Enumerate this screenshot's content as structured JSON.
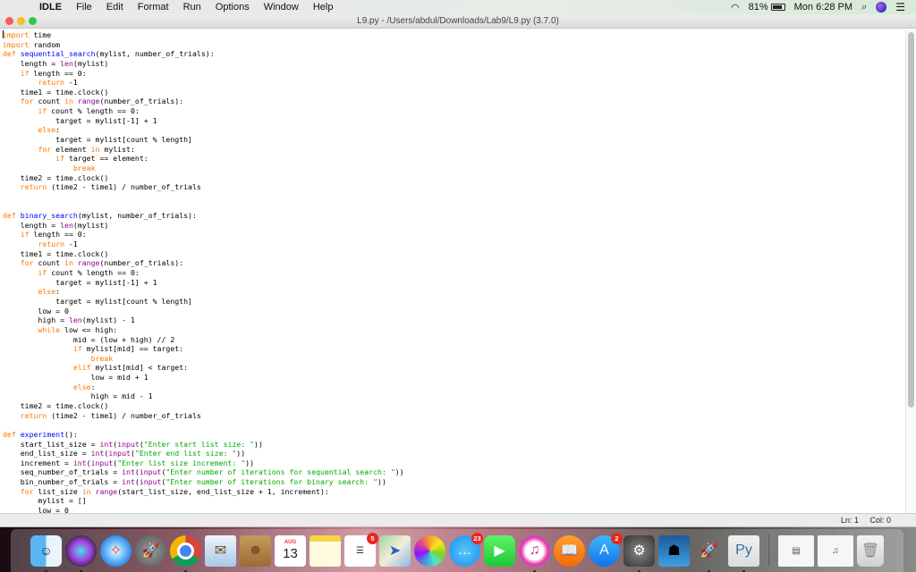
{
  "menubar": {
    "apple": "",
    "app_name": "IDLE",
    "items": [
      "File",
      "Edit",
      "Format",
      "Run",
      "Options",
      "Window",
      "Help"
    ],
    "battery_percent": "81%",
    "clock": "Mon 6:28 PM",
    "search_glyph": "⌕",
    "list_glyph": "☰",
    "wifi_glyph": "◠"
  },
  "window": {
    "title": "L9.py - /Users/abdul/Downloads/Lab9/L9.py (3.7.0)"
  },
  "editor": {
    "lines": [
      [
        [
          "kw",
          "import"
        ],
        [
          "",
          " time"
        ]
      ],
      [
        [
          "kw",
          "import"
        ],
        [
          "",
          " random"
        ]
      ],
      [
        [
          "kw",
          "def"
        ],
        [
          "",
          " "
        ],
        [
          "def",
          "sequential_search"
        ],
        [
          "",
          "(mylist, number_of_trials):"
        ]
      ],
      [
        [
          "",
          "    length = "
        ],
        [
          "bi",
          "len"
        ],
        [
          "",
          "(mylist)"
        ]
      ],
      [
        [
          "",
          "    "
        ],
        [
          "kw",
          "if"
        ],
        [
          "",
          " length == 0:"
        ]
      ],
      [
        [
          "",
          "        "
        ],
        [
          "kw",
          "return"
        ],
        [
          "",
          " -1"
        ]
      ],
      [
        [
          "",
          "    time1 = time.clock()"
        ]
      ],
      [
        [
          "",
          "    "
        ],
        [
          "kw",
          "for"
        ],
        [
          "",
          " count "
        ],
        [
          "kw",
          "in"
        ],
        [
          "",
          " "
        ],
        [
          "bi",
          "range"
        ],
        [
          "",
          "(number_of_trials):"
        ]
      ],
      [
        [
          "",
          "        "
        ],
        [
          "kw",
          "if"
        ],
        [
          "",
          " count % length == 0:"
        ]
      ],
      [
        [
          "",
          "            target = mylist[-1] + 1"
        ]
      ],
      [
        [
          "",
          "        "
        ],
        [
          "kw",
          "else"
        ],
        [
          "",
          ":"
        ]
      ],
      [
        [
          "",
          "            target = mylist[count % length]"
        ]
      ],
      [
        [
          "",
          "        "
        ],
        [
          "kw",
          "for"
        ],
        [
          "",
          " element "
        ],
        [
          "kw",
          "in"
        ],
        [
          "",
          " mylist:"
        ]
      ],
      [
        [
          "",
          "            "
        ],
        [
          "kw",
          "if"
        ],
        [
          "",
          " target == element:"
        ]
      ],
      [
        [
          "",
          "                "
        ],
        [
          "kw",
          "break"
        ]
      ],
      [
        [
          "",
          "    time2 = time.clock()"
        ]
      ],
      [
        [
          "",
          "    "
        ],
        [
          "kw",
          "return"
        ],
        [
          "",
          " (time2 - time1) / number_of_trials"
        ]
      ],
      [
        [
          "",
          ""
        ]
      ],
      [
        [
          "",
          ""
        ]
      ],
      [
        [
          "kw",
          "def"
        ],
        [
          "",
          " "
        ],
        [
          "def",
          "binary_search"
        ],
        [
          "",
          "(mylist, number_of_trials):"
        ]
      ],
      [
        [
          "",
          "    length = "
        ],
        [
          "bi",
          "len"
        ],
        [
          "",
          "(mylist)"
        ]
      ],
      [
        [
          "",
          "    "
        ],
        [
          "kw",
          "if"
        ],
        [
          "",
          " length == 0:"
        ]
      ],
      [
        [
          "",
          "        "
        ],
        [
          "kw",
          "return"
        ],
        [
          "",
          " -1"
        ]
      ],
      [
        [
          "",
          "    time1 = time.clock()"
        ]
      ],
      [
        [
          "",
          "    "
        ],
        [
          "kw",
          "for"
        ],
        [
          "",
          " count "
        ],
        [
          "kw",
          "in"
        ],
        [
          "",
          " "
        ],
        [
          "bi",
          "range"
        ],
        [
          "",
          "(number_of_trials):"
        ]
      ],
      [
        [
          "",
          "        "
        ],
        [
          "kw",
          "if"
        ],
        [
          "",
          " count % length == 0:"
        ]
      ],
      [
        [
          "",
          "            target = mylist[-1] + 1"
        ]
      ],
      [
        [
          "",
          "        "
        ],
        [
          "kw",
          "else"
        ],
        [
          "",
          ":"
        ]
      ],
      [
        [
          "",
          "            target = mylist[count % length]"
        ]
      ],
      [
        [
          "",
          "        low = 0"
        ]
      ],
      [
        [
          "",
          "        high = "
        ],
        [
          "bi",
          "len"
        ],
        [
          "",
          "(mylist) - 1"
        ]
      ],
      [
        [
          "",
          "        "
        ],
        [
          "kw",
          "while"
        ],
        [
          "",
          " low <= high:"
        ]
      ],
      [
        [
          "",
          "                mid = (low + high) // 2"
        ]
      ],
      [
        [
          "",
          "                "
        ],
        [
          "kw",
          "if"
        ],
        [
          "",
          " mylist[mid] == target:"
        ]
      ],
      [
        [
          "",
          "                    "
        ],
        [
          "kw",
          "break"
        ]
      ],
      [
        [
          "",
          "                "
        ],
        [
          "kw",
          "elif"
        ],
        [
          "",
          " mylist[mid] < target:"
        ]
      ],
      [
        [
          "",
          "                    low = mid + 1"
        ]
      ],
      [
        [
          "",
          "                "
        ],
        [
          "kw",
          "else"
        ],
        [
          "",
          ":"
        ]
      ],
      [
        [
          "",
          "                    high = mid - 1"
        ]
      ],
      [
        [
          "",
          "    time2 = time.clock()"
        ]
      ],
      [
        [
          "",
          "    "
        ],
        [
          "kw",
          "return"
        ],
        [
          "",
          " (time2 - time1) / number_of_trials"
        ]
      ],
      [
        [
          "",
          ""
        ]
      ],
      [
        [
          "kw",
          "def"
        ],
        [
          "",
          " "
        ],
        [
          "def",
          "experiment"
        ],
        [
          "",
          "():"
        ]
      ],
      [
        [
          "",
          "    start_list_size = "
        ],
        [
          "bi",
          "int"
        ],
        [
          "",
          "("
        ],
        [
          "bi",
          "input"
        ],
        [
          "",
          "("
        ],
        [
          "str",
          "\"Enter start list size: \""
        ],
        [
          "",
          "))"
        ]
      ],
      [
        [
          "",
          "    end_list_size = "
        ],
        [
          "bi",
          "int"
        ],
        [
          "",
          "("
        ],
        [
          "bi",
          "input"
        ],
        [
          "",
          "("
        ],
        [
          "str",
          "\"Enter end list size: \""
        ],
        [
          "",
          "))"
        ]
      ],
      [
        [
          "",
          "    increment = "
        ],
        [
          "bi",
          "int"
        ],
        [
          "",
          "("
        ],
        [
          "bi",
          "input"
        ],
        [
          "",
          "("
        ],
        [
          "str",
          "\"Enter list size increment: \""
        ],
        [
          "",
          "))"
        ]
      ],
      [
        [
          "",
          "    seq_number_of_trials = "
        ],
        [
          "bi",
          "int"
        ],
        [
          "",
          "("
        ],
        [
          "bi",
          "input"
        ],
        [
          "",
          "("
        ],
        [
          "str",
          "\"Enter number of iterations for sequential search: \""
        ],
        [
          "",
          "))"
        ]
      ],
      [
        [
          "",
          "    bin_number_of_trials = "
        ],
        [
          "bi",
          "int"
        ],
        [
          "",
          "("
        ],
        [
          "bi",
          "input"
        ],
        [
          "",
          "("
        ],
        [
          "str",
          "\"Enter number of iterations for binary search: \""
        ],
        [
          "",
          "))"
        ]
      ],
      [
        [
          "",
          "    "
        ],
        [
          "kw",
          "for"
        ],
        [
          "",
          " list_size "
        ],
        [
          "kw",
          "in"
        ],
        [
          "",
          " "
        ],
        [
          "bi",
          "range"
        ],
        [
          "",
          "(start_list_size, end_list_size + 1, increment):"
        ]
      ],
      [
        [
          "",
          "        mylist = []"
        ]
      ],
      [
        [
          "",
          "        low = 0"
        ]
      ]
    ]
  },
  "statusbar": {
    "line": "Ln: 1",
    "col": "Col: 0"
  },
  "dock": {
    "apps": [
      {
        "name": "finder",
        "glyph": "☺",
        "running": true,
        "badge": null
      },
      {
        "name": "siri",
        "glyph": "",
        "running": true,
        "badge": null
      },
      {
        "name": "safari",
        "glyph": "✧",
        "running": false,
        "badge": null
      },
      {
        "name": "launchpad",
        "glyph": "🚀",
        "running": false,
        "badge": null
      },
      {
        "name": "chrome",
        "glyph": "",
        "running": true,
        "badge": null
      },
      {
        "name": "mail",
        "glyph": "✉",
        "running": false,
        "badge": null
      },
      {
        "name": "contacts",
        "glyph": "☻",
        "running": false,
        "badge": null
      },
      {
        "name": "calendar",
        "glyph": "13",
        "month": "AUG",
        "running": false,
        "badge": null
      },
      {
        "name": "notes",
        "glyph": "",
        "running": false,
        "badge": null
      },
      {
        "name": "reminders",
        "glyph": "☰",
        "running": false,
        "badge": "5"
      },
      {
        "name": "maps",
        "glyph": "➤",
        "running": false,
        "badge": null
      },
      {
        "name": "photos",
        "glyph": "",
        "running": false,
        "badge": null
      },
      {
        "name": "messages",
        "glyph": "…",
        "running": false,
        "badge": "23"
      },
      {
        "name": "facetime",
        "glyph": "▶",
        "running": false,
        "badge": null
      },
      {
        "name": "itunes",
        "glyph": "♫",
        "running": true,
        "badge": null
      },
      {
        "name": "ibooks",
        "glyph": "📖",
        "running": false,
        "badge": null
      },
      {
        "name": "app-store",
        "glyph": "A",
        "running": false,
        "badge": "2"
      },
      {
        "name": "system-preferences",
        "glyph": "⚙",
        "running": true,
        "badge": null
      },
      {
        "name": "kindle",
        "glyph": "☗",
        "running": false,
        "badge": null
      },
      {
        "name": "python-launcher",
        "glyph": "🚀",
        "running": true,
        "badge": null
      },
      {
        "name": "idle-python",
        "glyph": "Py",
        "running": true,
        "badge": null
      }
    ],
    "stack_items": [
      {
        "name": "downloads-stack",
        "glyph": "▤"
      },
      {
        "name": "documents-stack",
        "glyph": "♫"
      },
      {
        "name": "trash",
        "glyph": "🗑"
      }
    ]
  }
}
